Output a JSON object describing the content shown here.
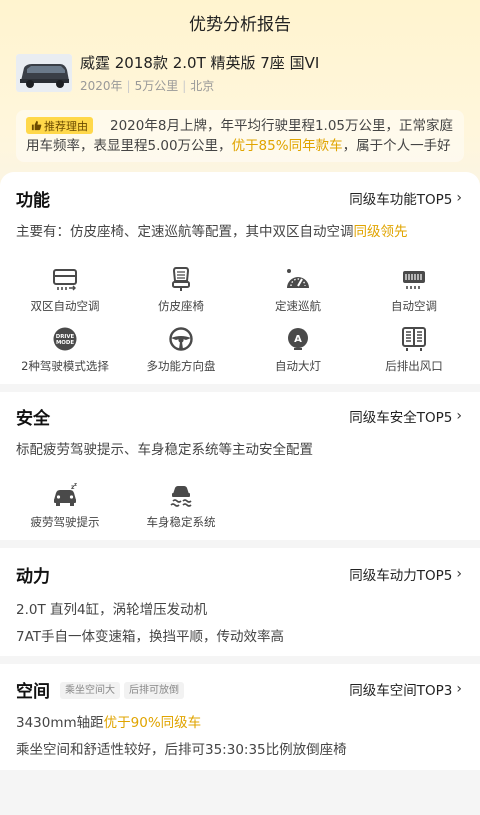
{
  "header": {
    "title": "优势分析报告"
  },
  "car": {
    "name": "威霆 2018款 2.0T 精英版 7座 国VI",
    "year": "2020年",
    "mileage": "5万公里",
    "city": "北京"
  },
  "reason": {
    "tag": "推荐理由",
    "text_a": "2020年8月上牌，年平均行驶里程1.05万公里，正常家庭用车频率，表显里程5.00万公里，",
    "text_hl": "优于85%同年款车",
    "text_b": "，属于个人一手好车"
  },
  "sections": {
    "function": {
      "title": "功能",
      "link": "同级车功能TOP5",
      "desc_a": "主要有：仿皮座椅、定速巡航等配置，其中双区自动空调",
      "desc_hl": "同级领先",
      "features": [
        {
          "icon": "dual-zone-ac-icon",
          "label": "双区自动空调"
        },
        {
          "icon": "leather-seat-icon",
          "label": "仿皮座椅"
        },
        {
          "icon": "cruise-control-icon",
          "label": "定速巡航"
        },
        {
          "icon": "auto-ac-icon",
          "label": "自动空调"
        },
        {
          "icon": "drive-mode-icon",
          "label": "2种驾驶模式选择",
          "icon_text": "DRIVE MODE"
        },
        {
          "icon": "steering-wheel-icon",
          "label": "多功能方向盘"
        },
        {
          "icon": "auto-headlight-icon",
          "label": "自动大灯"
        },
        {
          "icon": "rear-vent-icon",
          "label": "后排出风口"
        }
      ]
    },
    "safety": {
      "title": "安全",
      "link": "同级车安全TOP5",
      "desc": "标配疲劳驾驶提示、车身稳定系统等主动安全配置",
      "features": [
        {
          "icon": "fatigue-warning-icon",
          "label": "疲劳驾驶提示"
        },
        {
          "icon": "stability-control-icon",
          "label": "车身稳定系统"
        }
      ]
    },
    "power": {
      "title": "动力",
      "link": "同级车动力TOP5",
      "line1": "2.0T 直列4缸，涡轮增压发动机",
      "line2": "7AT手自一体变速箱，换挡平顺，传动效率高"
    },
    "space": {
      "title": "空间",
      "chips": [
        "乘坐空间大",
        "后排可放倒"
      ],
      "link": "同级车空间TOP3",
      "line1_a": "3430mm轴距",
      "line1_hl": "优于90%同级车",
      "line2": "乘坐空间和舒适性较好，后排可35:30:35比例放倒座椅"
    }
  },
  "colors": {
    "highlight": "#e0a400",
    "tag_bg": "#ffd84a",
    "icon": "#4a4a4a"
  }
}
